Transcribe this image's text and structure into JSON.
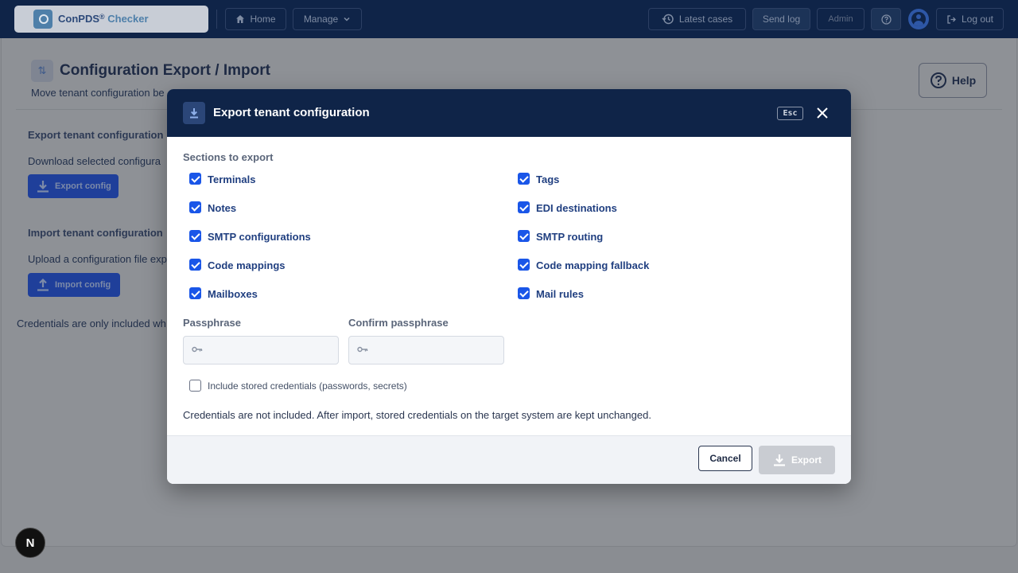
{
  "topbar": {
    "brand": {
      "name": "ConPDS",
      "reg": "®",
      "suffix": " Checker"
    },
    "home_label": "Home",
    "manage_label": "Manage",
    "latest_cases_label": "Latest cases",
    "send_log_label": "Send log",
    "admin_label": "Admin",
    "logout_label": "Log out"
  },
  "page": {
    "title": "Configuration Export / Import",
    "subtitle": "Move tenant configuration be",
    "help_label": "Help",
    "export_section": {
      "title": "Export tenant configuration",
      "desc": "Download selected configura",
      "button_label": "Export config"
    },
    "import_section": {
      "title": "Import tenant configuration",
      "desc": "Upload a configuration file exp",
      "button_label": "Import config"
    },
    "cred_note": "Credentials are only included wh",
    "fab_label": "N"
  },
  "modal": {
    "title": "Export tenant configuration",
    "esc_label": "Esc",
    "sections_label": "Sections to export",
    "sections": [
      {
        "label": "Terminals",
        "checked": true
      },
      {
        "label": "Tags",
        "checked": true
      },
      {
        "label": "Notes",
        "checked": true
      },
      {
        "label": "EDI destinations",
        "checked": true
      },
      {
        "label": "SMTP configurations",
        "checked": true
      },
      {
        "label": "SMTP routing",
        "checked": true
      },
      {
        "label": "Code mappings",
        "checked": true
      },
      {
        "label": "Code mapping fallback",
        "checked": true
      },
      {
        "label": "Mailboxes",
        "checked": true
      },
      {
        "label": "Mail rules",
        "checked": true
      }
    ],
    "passphrase_label": "Passphrase",
    "passphrase_value": "",
    "confirm_label": "Confirm passphrase",
    "confirm_value": "",
    "include_credentials_label": "Include stored credentials (passwords, secrets)",
    "include_credentials_checked": false,
    "note": "Credentials are not included. After import, stored credentials on the target system are kept unchanged.",
    "cancel_label": "Cancel",
    "export_label": "Export"
  },
  "colors": {
    "nav_bg": "#0f2448",
    "checkbox_blue": "#1a56e8",
    "label_blue": "#203f80",
    "primary_button": "#1f3f9a",
    "disabled_button": "#c9ccd2"
  }
}
